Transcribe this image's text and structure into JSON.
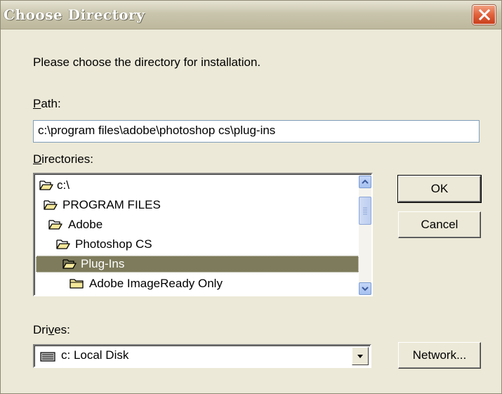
{
  "window": {
    "title": "Choose Directory"
  },
  "instructions": "Please choose the directory for installation.",
  "path": {
    "label_accel": "P",
    "label_rest": "ath:",
    "value": "c:\\program files\\adobe\\photoshop cs\\plug-ins"
  },
  "directories": {
    "label_accel": "D",
    "label_rest": "irectories:",
    "items": [
      {
        "label": "c:\\",
        "state": "open"
      },
      {
        "label": "PROGRAM FILES",
        "state": "open"
      },
      {
        "label": "Adobe",
        "state": "open"
      },
      {
        "label": "Photoshop CS",
        "state": "open"
      },
      {
        "label": "Plug-Ins",
        "state": "open",
        "selected": true
      },
      {
        "label": "Adobe ImageReady Only",
        "state": "closed"
      }
    ]
  },
  "buttons": {
    "ok": "OK",
    "cancel": "Cancel",
    "network": "Network..."
  },
  "drives": {
    "label_pre": "Dri",
    "label_accel": "v",
    "label_post": "es:",
    "selected": "c: Local Disk",
    "icon": "drive-icon"
  },
  "colors": {
    "dialog_bg": "#ece9d8",
    "selection": "#7d7b5b",
    "close_button": "#e0623c"
  }
}
